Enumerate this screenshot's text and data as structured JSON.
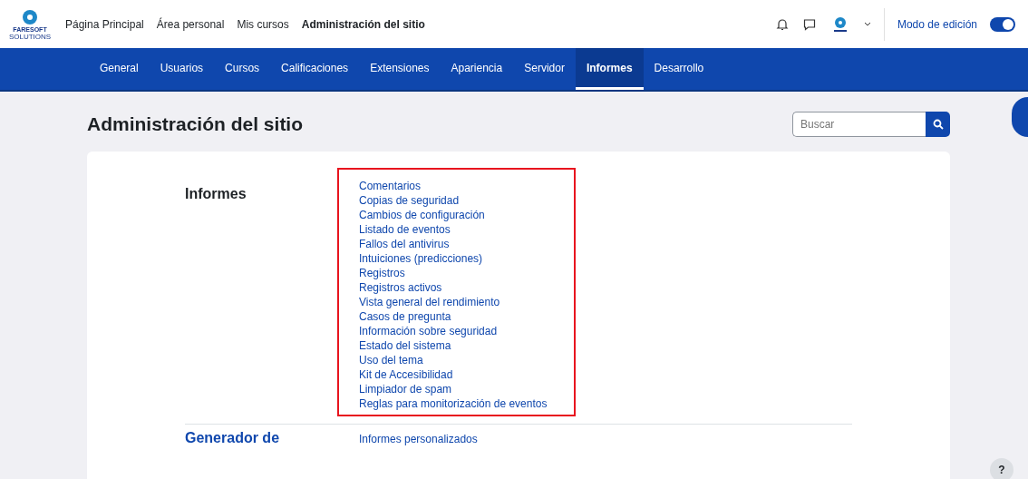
{
  "top_nav": {
    "logo_text": "FARESOFT",
    "logo_subtext": "SOLUTIONS",
    "links": [
      {
        "label": "Página Principal",
        "selected": false
      },
      {
        "label": "Área personal",
        "selected": false
      },
      {
        "label": "Mis cursos",
        "selected": false
      },
      {
        "label": "Administración del sitio",
        "selected": true
      }
    ],
    "edit_mode": {
      "label": "Modo de edición",
      "on": true
    }
  },
  "admin_tabs": [
    {
      "label": "General",
      "selected": false
    },
    {
      "label": "Usuarios",
      "selected": false
    },
    {
      "label": "Cursos",
      "selected": false
    },
    {
      "label": "Calificaciones",
      "selected": false
    },
    {
      "label": "Extensiones",
      "selected": false
    },
    {
      "label": "Apariencia",
      "selected": false
    },
    {
      "label": "Servidor",
      "selected": false
    },
    {
      "label": "Informes",
      "selected": true
    },
    {
      "label": "Desarrollo",
      "selected": false
    }
  ],
  "page_title": "Administración del sitio",
  "search": {
    "placeholder": "Buscar"
  },
  "sections": [
    {
      "heading": "Informes",
      "highlighted": true,
      "links": [
        "Comentarios",
        "Copias de seguridad",
        "Cambios de configuración",
        "Listado de eventos",
        "Fallos del antivirus",
        "Intuiciones (predicciones)",
        "Registros",
        "Registros activos",
        "Vista general del rendimiento",
        "Casos de pregunta",
        "Información sobre seguridad",
        "Estado del sistema",
        "Uso del tema",
        "Kit de Accesibilidad",
        "Limpiador de spam",
        "Reglas para monitorización de eventos"
      ]
    },
    {
      "heading": "Generador de",
      "highlighted": false,
      "links": [
        "Informes personalizados"
      ]
    }
  ],
  "help_button": "?"
}
